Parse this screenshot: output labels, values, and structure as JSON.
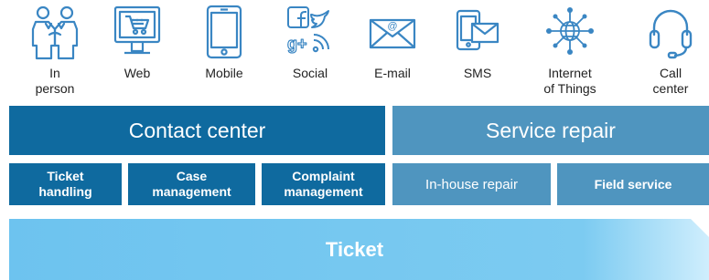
{
  "channels": [
    {
      "icon": "handshake-icon",
      "label": [
        "In",
        "person"
      ]
    },
    {
      "icon": "web-shopping-cart-icon",
      "label": [
        "Web"
      ]
    },
    {
      "icon": "mobile-phone-icon",
      "label": [
        "Mobile"
      ]
    },
    {
      "icon": "social-media-icon",
      "label": [
        "Social"
      ]
    },
    {
      "icon": "email-envelope-icon",
      "label": [
        "E-mail"
      ]
    },
    {
      "icon": "sms-icon",
      "label": [
        "SMS"
      ]
    },
    {
      "icon": "iot-network-icon",
      "label": [
        "Internet",
        "of Things"
      ]
    },
    {
      "icon": "headset-icon",
      "label": [
        "Call",
        "center"
      ]
    }
  ],
  "contact_center": {
    "title": "Contact center",
    "items": [
      {
        "line1": "Ticket",
        "line2": "handling"
      },
      {
        "line1": "Case",
        "line2": "management"
      },
      {
        "line1": "Complaint",
        "line2": "management"
      }
    ]
  },
  "service_repair": {
    "title": "Service repair",
    "items": [
      {
        "label": "In-house repair"
      },
      {
        "label": "Field service"
      }
    ]
  },
  "ticket": {
    "label": "Ticket"
  },
  "colors": {
    "icon_blue": "#3a86c3",
    "dark_blue": "#0f6a9f",
    "medium_blue": "#4f95bf",
    "ticket_light": "#6dc3ef",
    "ticket_fade": "#cfeefd"
  }
}
